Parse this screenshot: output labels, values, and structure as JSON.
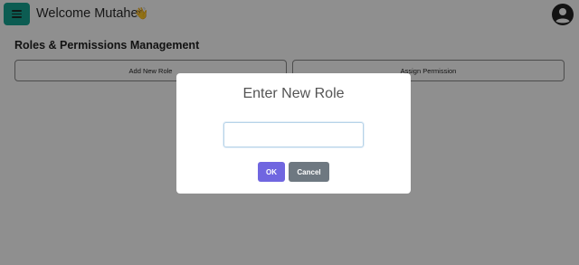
{
  "header": {
    "menu_icon": "hamburger-menu-icon",
    "welcome_text": "Welcome Mutaher",
    "wave_emoji": "👋",
    "user_icon": "user-circle-icon",
    "accent_color": "#16a592"
  },
  "main": {
    "title": "Roles & Permissions Management",
    "buttons": {
      "add_role": "Add New Role",
      "assign_permission": "Assign Permission"
    }
  },
  "modal": {
    "title": "Enter New Role",
    "input_value": "",
    "ok_label": "OK",
    "cancel_label": "Cancel",
    "ok_color": "#7066e0",
    "cancel_color": "#6e7881"
  }
}
